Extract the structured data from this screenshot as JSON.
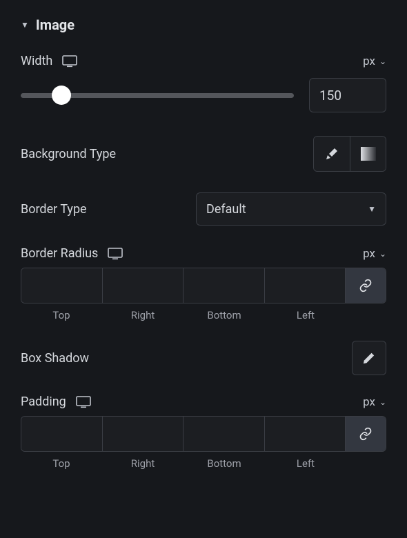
{
  "section": {
    "title": "Image"
  },
  "width": {
    "label": "Width",
    "unit": "px",
    "value": "150",
    "slider_percent": 15
  },
  "background_type": {
    "label": "Background Type"
  },
  "border_type": {
    "label": "Border Type",
    "value": "Default"
  },
  "border_radius": {
    "label": "Border Radius",
    "unit": "px",
    "sides": {
      "top": "Top",
      "right": "Right",
      "bottom": "Bottom",
      "left": "Left"
    }
  },
  "box_shadow": {
    "label": "Box Shadow"
  },
  "padding": {
    "label": "Padding",
    "unit": "px",
    "sides": {
      "top": "Top",
      "right": "Right",
      "bottom": "Bottom",
      "left": "Left"
    }
  }
}
